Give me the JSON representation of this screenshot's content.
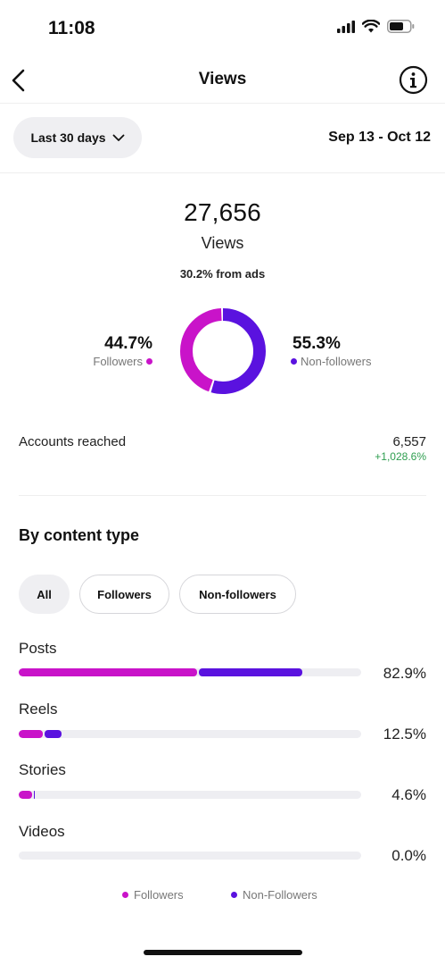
{
  "status_bar": {
    "time": "11:08"
  },
  "nav": {
    "title": "Views",
    "back_icon": "chevron-left-icon",
    "info_icon": "info-icon"
  },
  "filters": {
    "range_label": "Last 30 days",
    "date_range": "Sep 13 - Oct 12"
  },
  "summary": {
    "total": "27,656",
    "label": "Views",
    "ads_note": "30.2% from ads",
    "followers_pct": "44.7%",
    "followers_label": "Followers",
    "non_followers_pct": "55.3%",
    "non_followers_label": "Non-followers",
    "followers_share": 0.447,
    "non_followers_share": 0.553
  },
  "accounts_reached": {
    "label": "Accounts reached",
    "value": "6,557",
    "change": "+1,028.6%"
  },
  "content_type": {
    "title": "By content type",
    "chips": [
      "All",
      "Followers",
      "Non-followers"
    ],
    "selected_chip": "All",
    "rows": [
      {
        "label": "Posts",
        "pct": "82.9%",
        "total": 0.829,
        "followers": 0.52
      },
      {
        "label": "Reels",
        "pct": "12.5%",
        "total": 0.125,
        "followers": 0.07
      },
      {
        "label": "Stories",
        "pct": "4.6%",
        "total": 0.046,
        "followers": 0.04
      },
      {
        "label": "Videos",
        "pct": "0.0%",
        "total": 0.0,
        "followers": 0.0
      }
    ],
    "legend": {
      "followers": "Followers",
      "non_followers": "Non-Followers"
    }
  },
  "colors": {
    "followers": "#c913c9",
    "non_followers": "#5a12df",
    "positive": "#2e9e4f",
    "track": "#eeeef2"
  }
}
